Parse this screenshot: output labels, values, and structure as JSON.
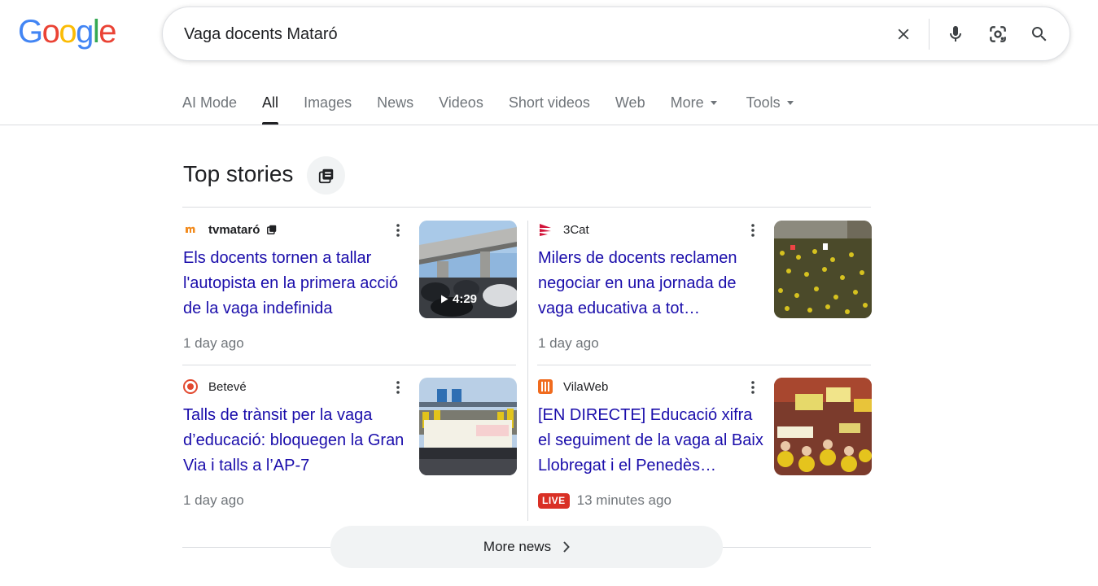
{
  "logo": {
    "letters": [
      "G",
      "o",
      "o",
      "g",
      "l",
      "e"
    ]
  },
  "search": {
    "query": "Vaga docents Mataró"
  },
  "tabs": [
    {
      "label": "AI Mode"
    },
    {
      "label": "All"
    },
    {
      "label": "Images"
    },
    {
      "label": "News"
    },
    {
      "label": "Videos"
    },
    {
      "label": "Short videos"
    },
    {
      "label": "Web"
    },
    {
      "label": "More"
    },
    {
      "label": "Tools"
    }
  ],
  "top_stories": {
    "title": "Top stories",
    "more_news_label": "More news",
    "stories": [
      {
        "source": "tvmataró",
        "headline": "Els docents tornen a tallar l'autopista en la primera acció de la vaga indefinida",
        "time": "1 day ago",
        "duration": "4:29",
        "live": ""
      },
      {
        "source": "3Cat",
        "headline": "Milers de docents reclamen negociar en una jornada de vaga educativa a tot…",
        "time": "1 day ago",
        "duration": "",
        "live": ""
      },
      {
        "source": "Betevé",
        "headline": "Talls de trànsit per la vaga d’educació: bloquegen la Gran Via i talls a l’AP-7",
        "time": "1 day ago",
        "duration": "",
        "live": ""
      },
      {
        "source": "VilaWeb",
        "headline": "[EN DIRECTE] Educació xifra el seguiment de la vaga al Baix Llobregat i el Penedès…",
        "time": "13 minutes ago",
        "duration": "",
        "live": "LIVE"
      }
    ]
  },
  "colors": {
    "link": "#1a0dab",
    "secondary_text": "#70757a",
    "live_badge": "#d93025",
    "google_blue": "#4285f4",
    "google_red": "#ea4335",
    "google_yellow": "#fbbc05",
    "google_green": "#34a853"
  },
  "icons": {
    "search_bar": [
      "clear-icon",
      "microphone-icon",
      "lens-camera-icon",
      "search-icon"
    ],
    "top_stories": "stacked-pages-icon",
    "story_menu": "more-vert-icon",
    "more_news": "chevron-right-icon"
  }
}
